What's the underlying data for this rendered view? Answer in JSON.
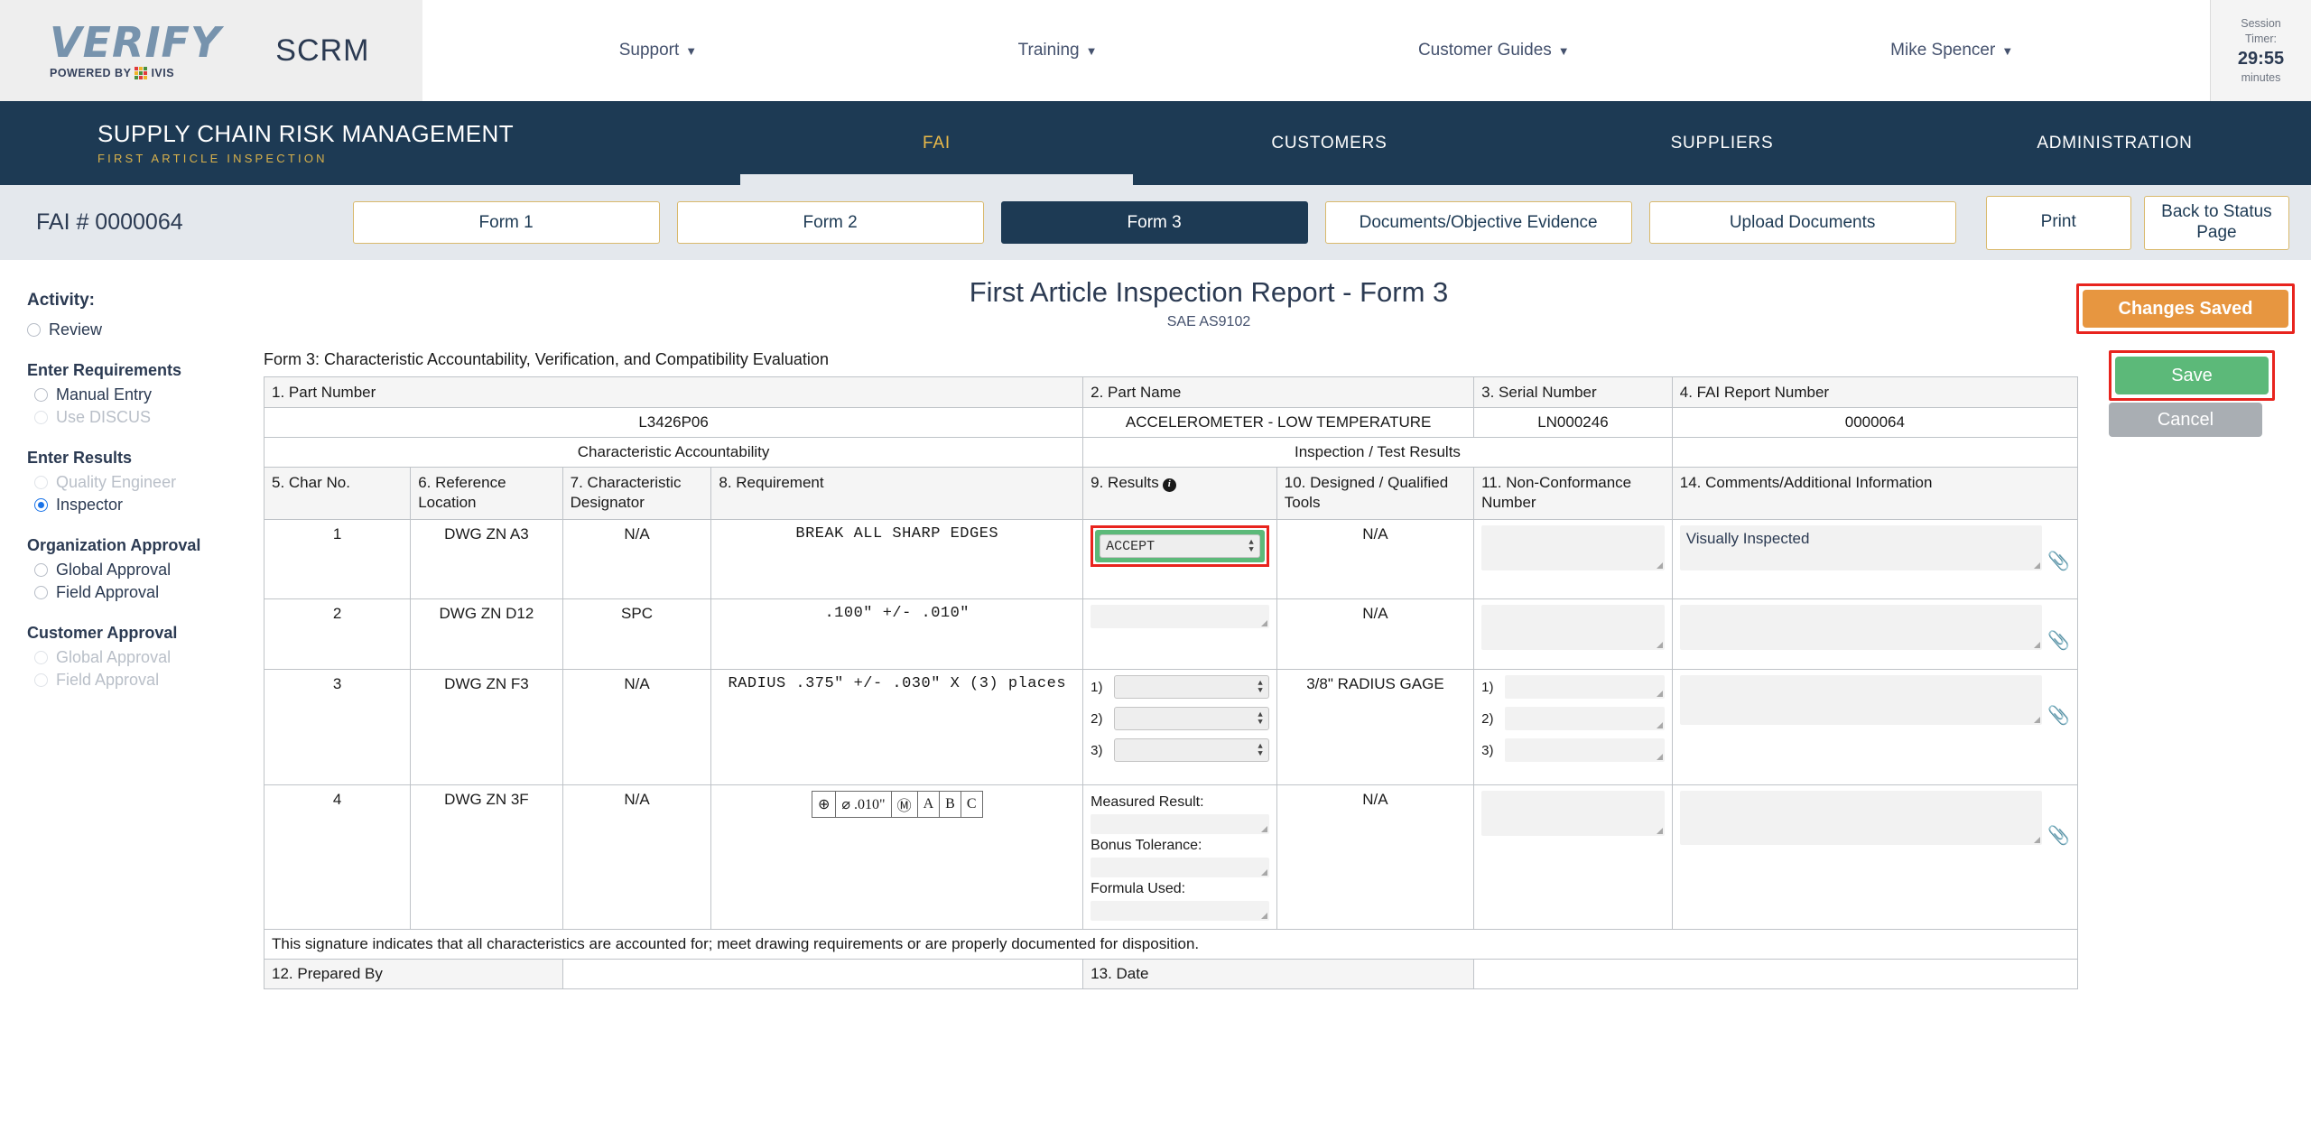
{
  "header": {
    "logo_text": "VERIFY",
    "logo_powered_by": "POWERED BY",
    "logo_ivis": "IVIS",
    "app_short": "SCRM",
    "nav": [
      {
        "label": "Support"
      },
      {
        "label": "Training"
      },
      {
        "label": "Customer Guides"
      },
      {
        "label": "Mike Spencer"
      }
    ],
    "session": {
      "label_line1": "Session",
      "label_line2": "Timer:",
      "time": "29:55",
      "unit": "minutes"
    }
  },
  "mainnav": {
    "brand_title": "SUPPLY CHAIN RISK MANAGEMENT",
    "brand_subtitle": "FIRST ARTICLE INSPECTION",
    "items": [
      {
        "label": "FAI",
        "active": true
      },
      {
        "label": "CUSTOMERS",
        "active": false
      },
      {
        "label": "SUPPLIERS",
        "active": false
      },
      {
        "label": "ADMINISTRATION",
        "active": false
      }
    ]
  },
  "tabbar": {
    "fai_number": "FAI # 0000064",
    "tabs": [
      {
        "label": "Form 1",
        "active": false
      },
      {
        "label": "Form 2",
        "active": false
      },
      {
        "label": "Form 3",
        "active": true
      },
      {
        "label": "Documents/Objective Evidence",
        "active": false
      },
      {
        "label": "Upload Documents",
        "active": false
      }
    ],
    "print_label": "Print",
    "back_label": "Back to Status Page"
  },
  "sidebar": {
    "activity_label": "Activity:",
    "review": {
      "label": "Review",
      "checked": false,
      "disabled": false
    },
    "groups": [
      {
        "title": "Enter Requirements",
        "options": [
          {
            "label": "Manual Entry",
            "checked": false,
            "disabled": false
          },
          {
            "label": "Use DISCUS",
            "checked": false,
            "disabled": true
          }
        ]
      },
      {
        "title": "Enter Results",
        "options": [
          {
            "label": "Quality Engineer",
            "checked": false,
            "disabled": true
          },
          {
            "label": "Inspector",
            "checked": true,
            "disabled": false
          }
        ]
      },
      {
        "title": "Organization Approval",
        "options": [
          {
            "label": "Global Approval",
            "checked": false,
            "disabled": false
          },
          {
            "label": "Field Approval",
            "checked": false,
            "disabled": false
          }
        ]
      },
      {
        "title": "Customer Approval",
        "options": [
          {
            "label": "Global Approval",
            "checked": false,
            "disabled": true
          },
          {
            "label": "Field Approval",
            "checked": false,
            "disabled": true
          }
        ]
      }
    ]
  },
  "document": {
    "title": "First Article Inspection Report - Form 3",
    "subtitle": "SAE AS9102",
    "form_label": "Form 3: Characteristic Accountability, Verification, and Compatibility Evaluation"
  },
  "actions": {
    "changes_saved": "Changes Saved",
    "save": "Save",
    "cancel": "Cancel",
    "changes_saved_color": "#e79640",
    "save_color": "#5cb979",
    "cancel_color": "#a9aeb3",
    "highlight_color": "#e8241e"
  },
  "part_header": {
    "labels": {
      "part_number": "1. Part Number",
      "part_name": "2. Part Name",
      "serial_number": "3. Serial Number",
      "fai_report_number": "4. FAI Report Number"
    },
    "values": {
      "part_number": "L3426P06",
      "part_name": "ACCELEROMETER - LOW TEMPERATURE",
      "serial_number": "LN000246",
      "fai_report_number": "0000064"
    },
    "band_left": "Characteristic Accountability",
    "band_right": "Inspection / Test Results"
  },
  "columns": {
    "char_no": "5. Char No.",
    "reference_location": "6. Reference Location",
    "characteristic_designator": "7. Characteristic Designator",
    "requirement": "8. Requirement",
    "results": "9. Results",
    "results_info_icon": "info-icon",
    "designed_qualified_tools": "10. Designed / Qualified Tools",
    "non_conformance_number": "11. Non-Conformance Number",
    "comments": "14. Comments/Additional Information"
  },
  "rows": [
    {
      "char_no": "1",
      "reference_location": "DWG ZN A3",
      "characteristic_designator": "N/A",
      "requirement": "BREAK  ALL  SHARP  EDGES",
      "requirement_type": "text",
      "results_type": "select",
      "results_value": "ACCEPT",
      "results_highlighted": true,
      "results_accepted": true,
      "tools": "N/A",
      "non_conformance": "",
      "comments": "Visually Inspected"
    },
    {
      "char_no": "2",
      "reference_location": "DWG ZN D12",
      "characteristic_designator": "SPC",
      "requirement": ".100\"  +/-  .010\"",
      "requirement_type": "text",
      "results_type": "input",
      "results_value": "",
      "results_highlighted": false,
      "results_accepted": false,
      "tools": "N/A",
      "non_conformance": "",
      "comments": ""
    },
    {
      "char_no": "3",
      "reference_location": "DWG ZN F3",
      "characteristic_designator": "N/A",
      "requirement": "RADIUS  .375\"  +/-  .030\"  X  (3)  places",
      "requirement_type": "text",
      "results_type": "multi-select",
      "results_items": [
        "1)",
        "2)",
        "3)"
      ],
      "results_highlighted": false,
      "tools": "3/8\" RADIUS GAGE",
      "non_conformance_items": [
        "1)",
        "2)",
        "3)"
      ],
      "comments": ""
    },
    {
      "char_no": "4",
      "reference_location": "DWG ZN 3F",
      "characteristic_designator": "N/A",
      "requirement_type": "gdt",
      "gdt_frame": [
        "⊕",
        "⌀ .010\"",
        "Ⓜ",
        "A",
        "B",
        "C"
      ],
      "results_type": "measured-group",
      "results_fields": [
        {
          "label": "Measured Result:",
          "value": ""
        },
        {
          "label": "Bonus Tolerance:",
          "value": ""
        },
        {
          "label": "Formula Used:",
          "value": ""
        }
      ],
      "results_highlighted": false,
      "tools": "N/A",
      "non_conformance": "",
      "comments": ""
    }
  ],
  "signature": {
    "note": "This signature indicates that all characteristics are accounted for; meet drawing requirements or are properly documented for disposition.",
    "prepared_by_label": "12. Prepared By",
    "prepared_by_value": "",
    "date_label": "13. Date",
    "date_value": ""
  }
}
